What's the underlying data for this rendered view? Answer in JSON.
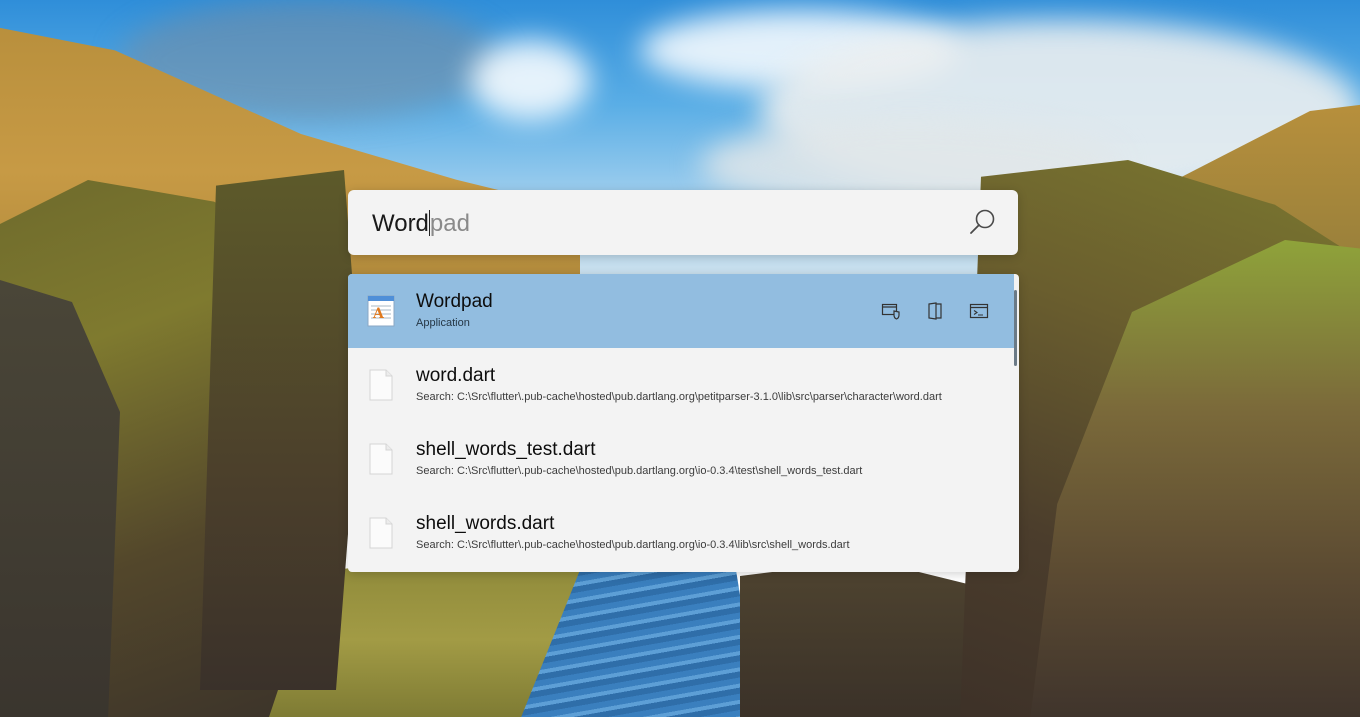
{
  "search": {
    "typed": "Word",
    "suggestion": "pad"
  },
  "results": [
    {
      "title": "Wordpad",
      "subtitle": "Application",
      "icon": "wordpad-app-icon",
      "selected": true,
      "actions": [
        {
          "name": "run-as-admin-icon"
        },
        {
          "name": "open-location-icon"
        },
        {
          "name": "open-console-icon"
        }
      ]
    },
    {
      "title": "word.dart",
      "subtitle": "Search: C:\\Src\\flutter\\.pub-cache\\hosted\\pub.dartlang.org\\petitparser-3.1.0\\lib\\src\\parser\\character\\word.dart",
      "icon": "file-icon"
    },
    {
      "title": "shell_words_test.dart",
      "subtitle": "Search: C:\\Src\\flutter\\.pub-cache\\hosted\\pub.dartlang.org\\io-0.3.4\\test\\shell_words_test.dart",
      "icon": "file-icon"
    },
    {
      "title": "shell_words.dart",
      "subtitle": "Search: C:\\Src\\flutter\\.pub-cache\\hosted\\pub.dartlang.org\\io-0.3.4\\lib\\src\\shell_words.dart",
      "icon": "file-icon"
    }
  ],
  "colors": {
    "selected_row": "#92bde0",
    "panel": "#f3f3f3"
  }
}
